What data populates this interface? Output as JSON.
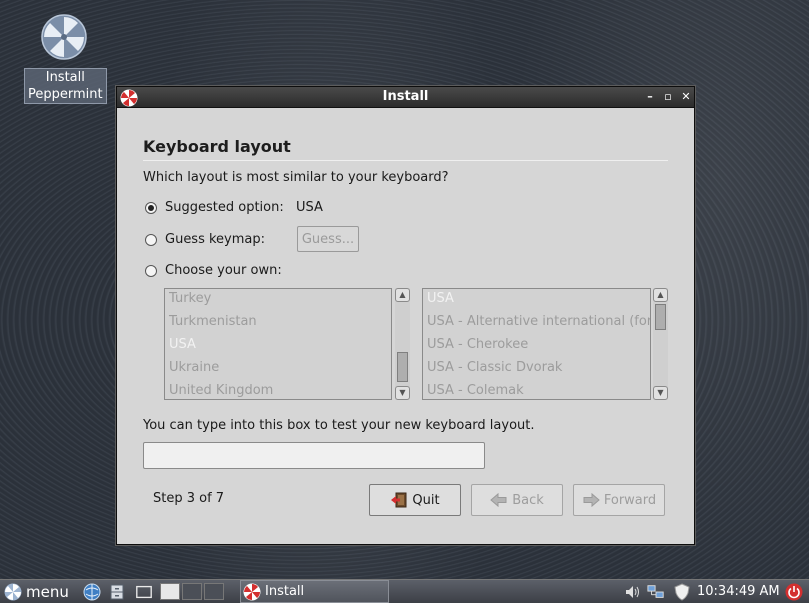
{
  "desktop": {
    "icon_label_line1": "Install",
    "icon_label_line2": "Peppermint"
  },
  "window": {
    "title": "Install",
    "controls": {
      "minimize": "–",
      "maximize": "▫",
      "close": "✕"
    }
  },
  "page": {
    "heading": "Keyboard layout",
    "question": "Which layout is most similar to your keyboard?",
    "options": {
      "suggested_label": "Suggested option:",
      "suggested_value": "USA",
      "guess_label": "Guess keymap:",
      "guess_button": "Guess...",
      "choose_label": "Choose your own:"
    },
    "selected_option": "suggested",
    "layouts": [
      "Turkey",
      "Turkmenistan",
      "USA",
      "Ukraine",
      "United Kingdom"
    ],
    "selected_layout": "USA",
    "variants": [
      "USA",
      "USA - Alternative international (for",
      "USA - Cherokee",
      "USA - Classic Dvorak",
      "USA - Colemak"
    ],
    "selected_variant": "USA",
    "test_hint": "You can type into this box to test your new keyboard layout.",
    "test_value": "",
    "step": "Step 3 of 7",
    "buttons": {
      "quit": "Quit",
      "back": "Back",
      "forward": "Forward"
    }
  },
  "taskbar": {
    "menu_label": "menu",
    "task_label": "Install",
    "clock": "10:34:49 AM"
  },
  "colors": {
    "accent_red": "#d32f2f",
    "window_bg": "#d6d6d6",
    "titlebar": "#3a3a3a"
  }
}
